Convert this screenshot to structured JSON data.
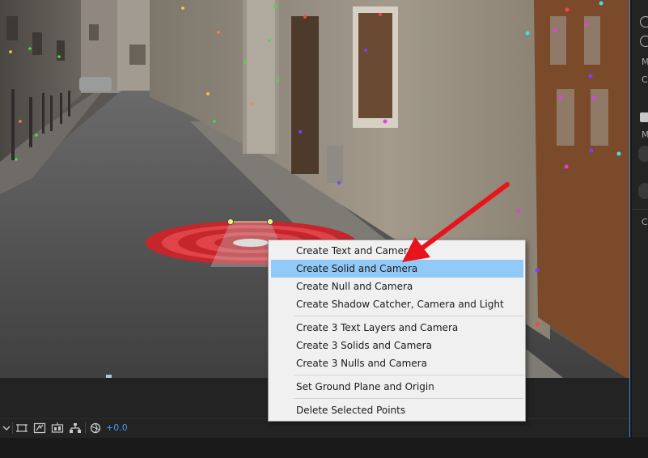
{
  "context_menu": {
    "items": [
      {
        "label": "Create Text and Camera",
        "highlighted": false
      },
      {
        "label": "Create Solid and Camera",
        "highlighted": true
      },
      {
        "label": "Create Null and Camera",
        "highlighted": false
      },
      {
        "label": "Create Shadow Catcher, Camera and Light",
        "highlighted": false
      },
      {
        "label": "Create 3 Text Layers and Camera",
        "highlighted": false
      },
      {
        "label": "Create 3 Solids and Camera",
        "highlighted": false
      },
      {
        "label": "Create 3 Nulls and Camera",
        "highlighted": false
      },
      {
        "label": "Set Ground Plane and Origin",
        "highlighted": false
      },
      {
        "label": "Delete Selected Points",
        "highlighted": false
      }
    ],
    "highlight_color": "#91c9f7"
  },
  "toolbar": {
    "exposure_value": "+0.0",
    "icons": [
      "chevron-down-icon",
      "region-of-interest-icon",
      "transparency-grid-icon",
      "fast-preview-icon",
      "flowchart-icon",
      "exposure-icon"
    ]
  },
  "right_panel": {
    "letters": [
      "M",
      "C",
      "M",
      "C"
    ]
  },
  "annotation": {
    "arrow_color": "#e8141c"
  },
  "target": {
    "colors": [
      "#c4262c",
      "#e0434a"
    ]
  }
}
